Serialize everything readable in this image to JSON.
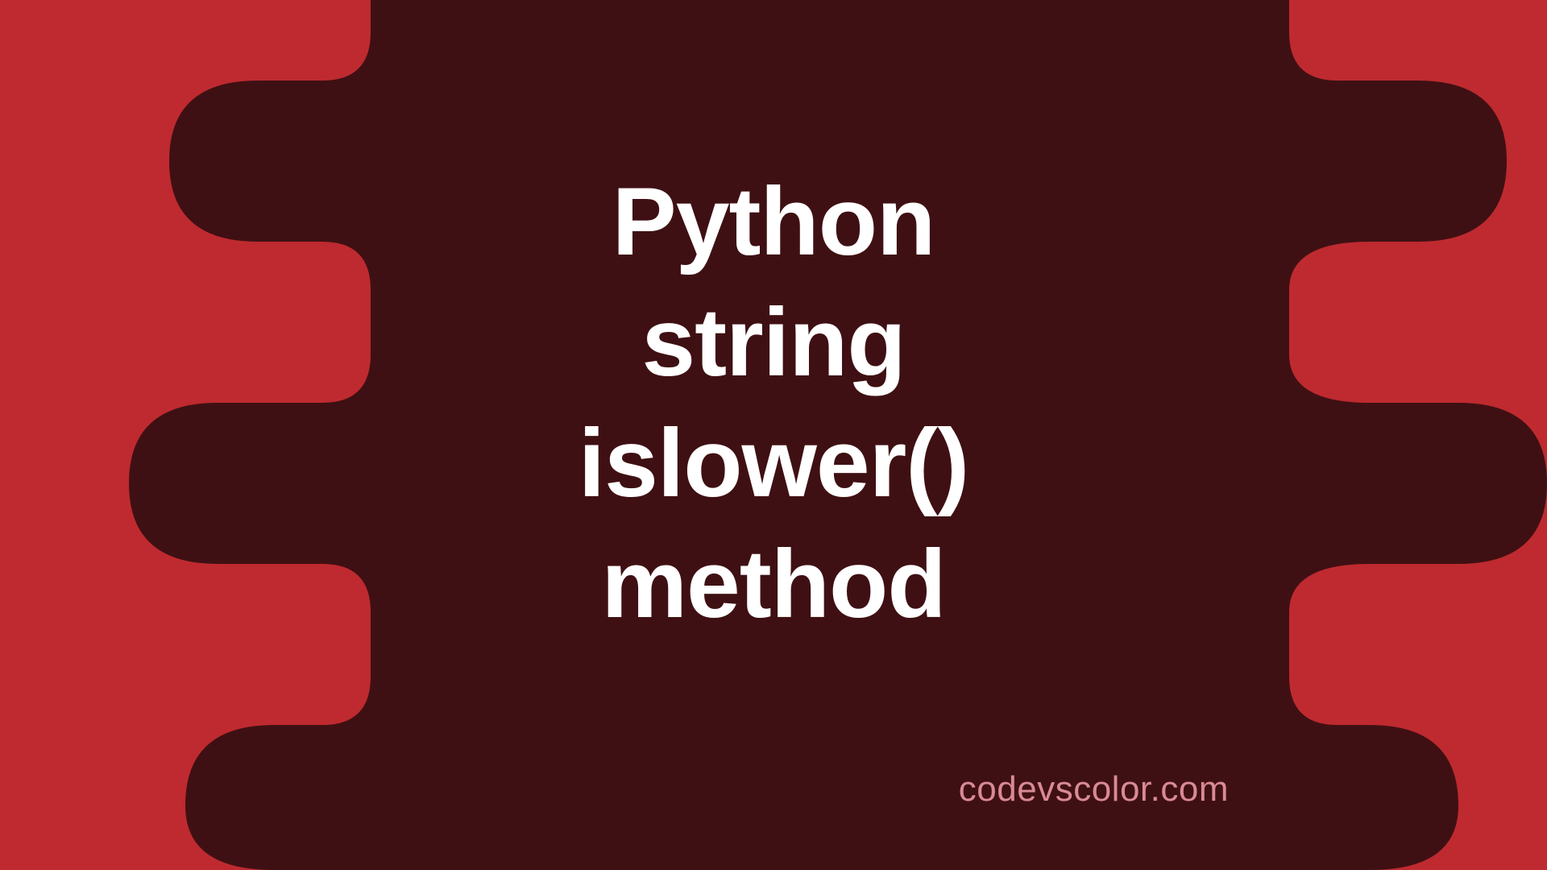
{
  "colors": {
    "background": "#BE2A2F",
    "blob": "#3F1013",
    "title": "#FFFFFF",
    "watermark": "#D98A94"
  },
  "title": {
    "line1": "Python",
    "line2": "string",
    "line3": "islower()",
    "line4": "method"
  },
  "watermark": "codevscolor.com"
}
